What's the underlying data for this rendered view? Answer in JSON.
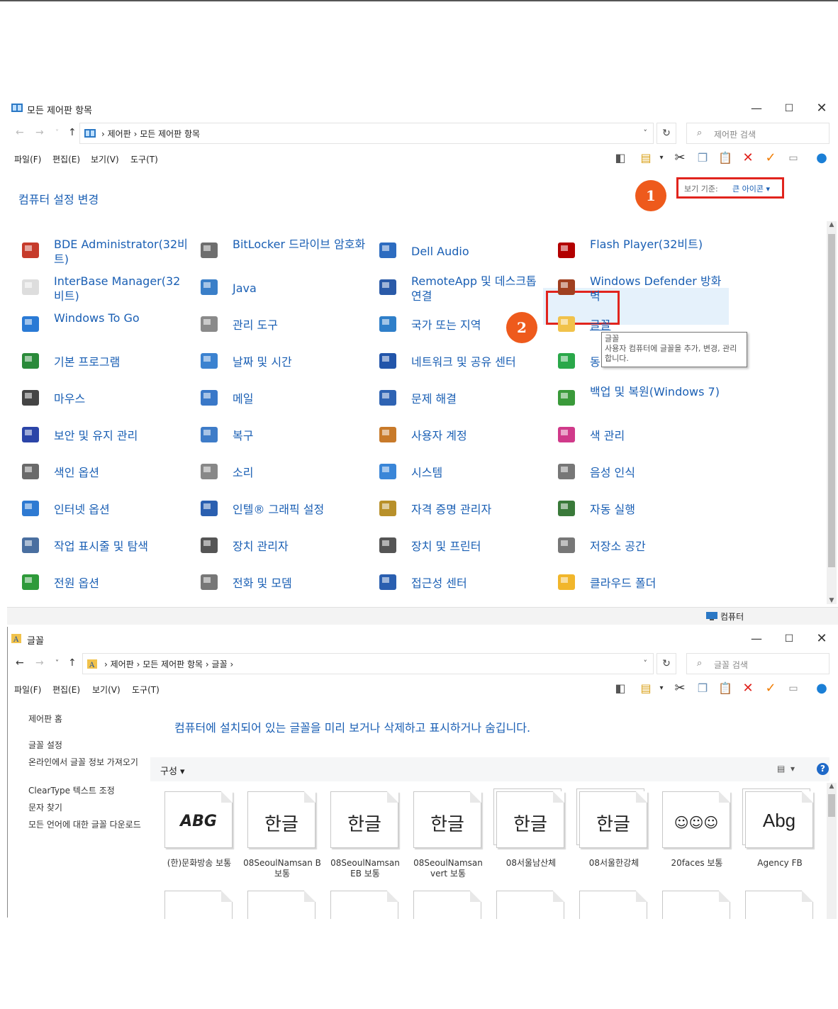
{
  "cp_window": {
    "title": "모든 제어판 항목",
    "breadcrumbs": [
      "제어판",
      "모든 제어판 항목"
    ],
    "search_placeholder": "제어판 검색",
    "menu": [
      "파일(F)",
      "편집(E)",
      "보기(V)",
      "도구(T)"
    ],
    "header": "컴퓨터 설정 변경",
    "view_by_label": "보기 기준:",
    "view_by_value": "큰 아이콘 ▾",
    "badge1": "1",
    "badge2": "2",
    "items": [
      {
        "label": "BDE Administrator(32비트)",
        "icon": "bde-icon"
      },
      {
        "label": "BitLocker 드라이브 암호화",
        "icon": "bitlocker-icon"
      },
      {
        "label": "Dell Audio",
        "icon": "dell-audio-icon"
      },
      {
        "label": "Flash Player(32비트)",
        "icon": "flash-icon"
      },
      {
        "label": "InterBase Manager(32비트)",
        "icon": "interbase-icon"
      },
      {
        "label": "Java",
        "icon": "java-icon"
      },
      {
        "label": "RemoteApp 및 데스크톱 연결",
        "icon": "remoteapp-icon"
      },
      {
        "label": "Windows Defender 방화벽",
        "icon": "firewall-icon"
      },
      {
        "label": "Windows To Go",
        "icon": "windows-to-go-icon"
      },
      {
        "label": "관리 도구",
        "icon": "admin-tools-icon"
      },
      {
        "label": "국가 또는 지역",
        "icon": "region-icon"
      },
      {
        "label": "글꼴",
        "icon": "fonts-icon"
      },
      {
        "label": "기본 프로그램",
        "icon": "default-programs-icon"
      },
      {
        "label": "날짜 및 시간",
        "icon": "date-time-icon"
      },
      {
        "label": "네트워크 및 공유 센터",
        "icon": "network-icon"
      },
      {
        "label": "동",
        "icon": "sync-icon"
      },
      {
        "label": "마우스",
        "icon": "mouse-icon"
      },
      {
        "label": "메일",
        "icon": "mail-icon"
      },
      {
        "label": "문제 해결",
        "icon": "troubleshoot-icon"
      },
      {
        "label": "백업 및 복원(Windows 7)",
        "icon": "backup-icon"
      },
      {
        "label": "보안 및 유지 관리",
        "icon": "security-flag-icon"
      },
      {
        "label": "복구",
        "icon": "recovery-icon"
      },
      {
        "label": "사용자 계정",
        "icon": "user-accounts-icon"
      },
      {
        "label": "색 관리",
        "icon": "color-mgmt-icon"
      },
      {
        "label": "색인 옵션",
        "icon": "indexing-icon"
      },
      {
        "label": "소리",
        "icon": "sound-icon"
      },
      {
        "label": "시스템",
        "icon": "system-icon"
      },
      {
        "label": "음성 인식",
        "icon": "microphone-icon"
      },
      {
        "label": "인터넷 옵션",
        "icon": "internet-options-icon"
      },
      {
        "label": "인텔® 그래픽 설정",
        "icon": "intel-graphics-icon"
      },
      {
        "label": "자격 증명 관리자",
        "icon": "credential-icon"
      },
      {
        "label": "자동 실행",
        "icon": "autoplay-icon"
      },
      {
        "label": "작업 표시줄 및 탐색",
        "icon": "taskbar-icon"
      },
      {
        "label": "장치 관리자",
        "icon": "device-manager-icon"
      },
      {
        "label": "장치 및 프린터",
        "icon": "printer-icon"
      },
      {
        "label": "저장소 공간",
        "icon": "storage-icon"
      },
      {
        "label": "전원 옵션",
        "icon": "power-icon"
      },
      {
        "label": "전화 및 모뎀",
        "icon": "phone-modem-icon"
      },
      {
        "label": "접근성 센터",
        "icon": "accessibility-icon"
      },
      {
        "label": "클라우드 폴더",
        "icon": "cloud-folder-icon"
      }
    ],
    "tooltip_title": "글꼴",
    "tooltip_body": "사용자 컴퓨터에 글꼴을 추가, 변경, 관리합니다.",
    "status_text": "컴퓨터"
  },
  "fonts_window": {
    "title": "글꼴",
    "breadcrumbs": [
      "제어판",
      "모든 제어판 항목",
      "글꼴"
    ],
    "search_placeholder": "글꼴 검색",
    "menu": [
      "파일(F)",
      "편집(E)",
      "보기(V)",
      "도구(T)"
    ],
    "left_links": [
      "제어판 홈",
      "글꼴 설정",
      "온라인에서 글꼴 정보 가져오기",
      "ClearType 텍스트 조정",
      "문자 찾기",
      "모든 언어에 대한 글꼴 다운로드"
    ],
    "header": "컴퓨터에 설치되어 있는 글꼴을 미리 보거나 삭제하고 표시하거나 숨깁니다.",
    "organize_label": "구성 ▾",
    "help_label": "?",
    "fonts": [
      {
        "sample": "ABG",
        "name": "(한)문화방송 보통",
        "stacked": false
      },
      {
        "sample": "한글",
        "name": "08SeoulNamsan B 보통",
        "stacked": false
      },
      {
        "sample": "한글",
        "name": "08SeoulNamsan EB 보통",
        "stacked": false
      },
      {
        "sample": "한글",
        "name": "08SeoulNamsan vert 보통",
        "stacked": false
      },
      {
        "sample": "한글",
        "name": "08서울남산체",
        "stacked": true
      },
      {
        "sample": "한글",
        "name": "08서울한강체",
        "stacked": true
      },
      {
        "sample": "☺☺☺",
        "name": "20faces 보통",
        "stacked": false
      },
      {
        "sample": "Abg",
        "name": "Agency FB",
        "stacked": true
      }
    ]
  }
}
